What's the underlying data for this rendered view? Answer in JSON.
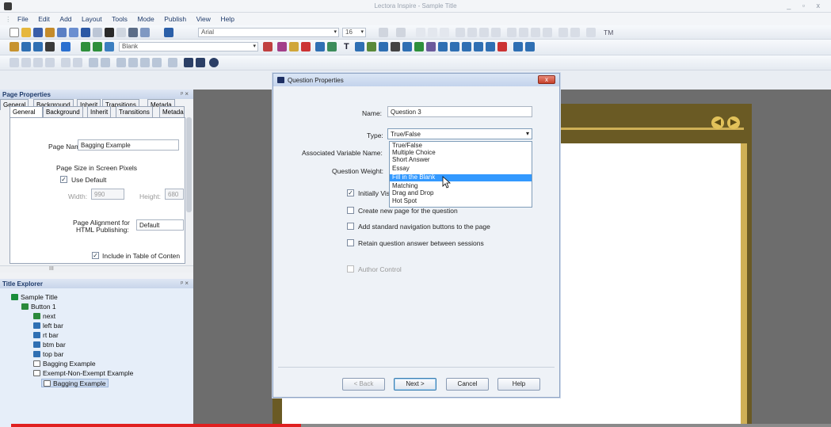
{
  "window": {
    "title": "Lectora Inspire - Sample Title",
    "controls": "_ ▫ x"
  },
  "menu": [
    "File",
    "Edit",
    "Add",
    "Layout",
    "Tools",
    "Mode",
    "Publish",
    "View",
    "Help"
  ],
  "toolbar": {
    "font": "Arial",
    "font_size": "16",
    "page_combo": "Blank",
    "tm": "TM"
  },
  "page_properties": {
    "header": "Page Properties",
    "header_controls": "ᵖ ×",
    "tabs": [
      "General",
      "Background",
      "Inherit",
      "Transitions",
      "Metada"
    ],
    "page_name_label": "Page Name:",
    "page_name": "Bagging Example",
    "size_group": "Page Size in Screen Pixels",
    "use_default": "Use Default",
    "width_label": "Width:",
    "width": "990",
    "height_label": "Height:",
    "height": "680",
    "alignment_label_1": "Page Alignment for",
    "alignment_label_2": "HTML Publishing:",
    "alignment": "Default",
    "include_toc": "Include in Table of Conten",
    "hscroll_label": "III"
  },
  "title_explorer": {
    "header": "Title Explorer",
    "header_controls": "ᵖ ×",
    "items": [
      {
        "label": "Sample Title"
      },
      {
        "label": "Button 1"
      },
      {
        "label": "next"
      },
      {
        "label": "left bar"
      },
      {
        "label": "rt bar"
      },
      {
        "label": "btm bar"
      },
      {
        "label": "top bar"
      },
      {
        "label": "Bagging Example"
      },
      {
        "label": "Exempt-Non-Exempt Example"
      },
      {
        "label": "Bagging Example"
      }
    ]
  },
  "dialog": {
    "title": "Question Properties",
    "close": "x",
    "name_label": "Name:",
    "name": "Question 3",
    "type_label": "Type:",
    "type": "True/False",
    "assoc_var_label": "Associated Variable Name:",
    "weight_label": "Question Weight:",
    "type_options": [
      "True/False",
      "Multiple Choice",
      "Short Answer",
      "Essay",
      "Fill in the Blank",
      "Matching",
      "Drag and Drop",
      "Hot Spot"
    ],
    "highlighted_option": "Fill in the Blank",
    "initially_visible": "Initially Vis",
    "create_new_page": "Create new page for the question",
    "add_nav": "Add standard navigation buttons to the page",
    "retain_answer": "Retain question answer between sessions",
    "author_control": "Author Control",
    "buttons": {
      "back": "< Back",
      "next": "Next >",
      "cancel": "Cancel",
      "help": "Help"
    }
  },
  "colors": {
    "accent": "#3399ff",
    "stage": "#6a5a24",
    "gold": "#e2c25a",
    "progress": "#e02020"
  }
}
